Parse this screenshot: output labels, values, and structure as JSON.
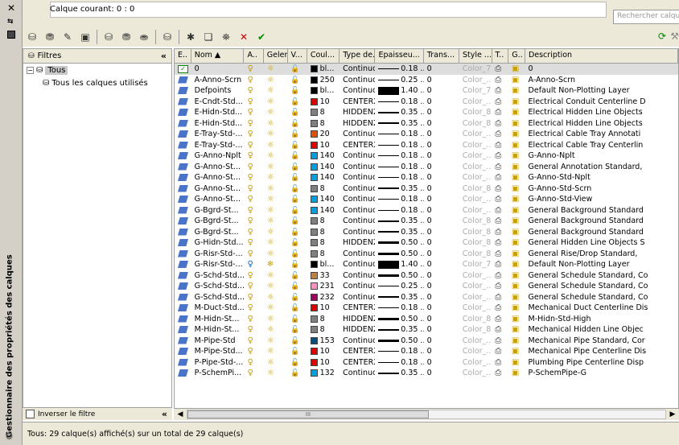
{
  "strip": {
    "title": "Gestionnaire des propriétés des calques",
    "close_icon": "close-icon",
    "autohide_icon": "autohide-icon",
    "menu_icon": "properties-menu-icon"
  },
  "header": {
    "current_layer": "Calque courant: 0 : 0",
    "search_placeholder": "Rechercher calque"
  },
  "toolbar": {
    "buttons": [
      "new-filter-icon",
      "new-group-filter-icon",
      "state-manager-icon",
      "save-icon",
      "layer-isolate-icon",
      "layer-walk-icon",
      "layer-match-icon",
      "layer-previous-icon",
      "new-layer-icon",
      "new-vp-frozen-layer-icon",
      "set-current-icon",
      "delete-layer-icon",
      "set-current-check-icon"
    ],
    "refresh_icon": "refresh-icon",
    "settings_icon": "settings-wrench-icon"
  },
  "filters": {
    "title": "Filtres",
    "tree_root": "Tous",
    "tree_child": "Tous les calques utilisés",
    "invert_label": "Inverser le filtre"
  },
  "columns": [
    "E..",
    "Nom",
    "A..",
    "Geler",
    "V...",
    "Coul...",
    "Type de...",
    "Epaisseu...",
    "Trans...",
    "Style ...",
    "T..",
    "G..",
    "Description"
  ],
  "rows": [
    {
      "name": "0",
      "color": "#000000",
      "color_label": "bl...",
      "ltype": "Continuo...",
      "lw": "0.18 ...",
      "lw_h": 1,
      "trans": "0",
      "style": "Color_7",
      "desc": "0",
      "current": true,
      "style_grey": true
    },
    {
      "name": "A-Anno-Scrn",
      "color": "#000000",
      "color_label": "250",
      "ltype": "Continuo...",
      "lw": "0.25 ...",
      "lw_h": 1,
      "trans": "0",
      "style": "Color_...",
      "desc": "A-Anno-Scrn"
    },
    {
      "name": "Defpoints",
      "color": "#000000",
      "color_label": "bl...",
      "ltype": "Continuo...",
      "lw": "1.40 ...",
      "lw_h": 10,
      "trans": "0",
      "style": "Color_7",
      "desc": "Default Non-Plotting Layer",
      "noplot": true
    },
    {
      "name": "E-Cndt-Std...",
      "color": "#e00000",
      "color_label": "10",
      "ltype": "CENTER2",
      "lw": "0.18 ...",
      "lw_h": 1,
      "trans": "0",
      "style": "Color_...",
      "desc": "Electrical Conduit Centerline D"
    },
    {
      "name": "E-Hidn-Std...",
      "color": "#808080",
      "color_label": "8",
      "ltype": "HIDDEN2",
      "lw": "0.35 ...",
      "lw_h": 2,
      "trans": "0",
      "style": "Color_8",
      "desc": "Electrical Hidden Line Objects"
    },
    {
      "name": "E-Hidn-Std...",
      "color": "#808080",
      "color_label": "8",
      "ltype": "HIDDEN2",
      "lw": "0.35 ...",
      "lw_h": 2,
      "trans": "0",
      "style": "Color_8",
      "desc": "Electrical Hidden Line Objects"
    },
    {
      "name": "E-Tray-Std-...",
      "color": "#e05000",
      "color_label": "20",
      "ltype": "Continuo...",
      "lw": "0.18 ...",
      "lw_h": 1,
      "trans": "0",
      "style": "Color_...",
      "desc": "Electrical Cable Tray Annotati"
    },
    {
      "name": "E-Tray-Std-...",
      "color": "#e00000",
      "color_label": "10",
      "ltype": "CENTER2",
      "lw": "0.18 ...",
      "lw_h": 1,
      "trans": "0",
      "style": "Color_...",
      "desc": "Electrical Cable Tray Centerlin"
    },
    {
      "name": "G-Anno-Nplt",
      "color": "#00a0e0",
      "color_label": "140",
      "ltype": "Continuo...",
      "lw": "0.18 ...",
      "lw_h": 1,
      "trans": "0",
      "style": "Color_...",
      "desc": "G-Anno-Nplt",
      "noplot": true
    },
    {
      "name": "G-Anno-St...",
      "color": "#00a0e0",
      "color_label": "140",
      "ltype": "Continuo...",
      "lw": "0.18 ...",
      "lw_h": 1,
      "trans": "0",
      "style": "Color_...",
      "desc": "General Annotation Standard,"
    },
    {
      "name": "G-Anno-St...",
      "color": "#00a0e0",
      "color_label": "140",
      "ltype": "Continuo...",
      "lw": "0.18 ...",
      "lw_h": 1,
      "trans": "0",
      "style": "Color_...",
      "desc": "G-Anno-Std-Nplt",
      "noplot": true
    },
    {
      "name": "G-Anno-St...",
      "color": "#808080",
      "color_label": "8",
      "ltype": "Continuo...",
      "lw": "0.35 ...",
      "lw_h": 2,
      "trans": "0",
      "style": "Color_8",
      "desc": "G-Anno-Std-Scrn"
    },
    {
      "name": "G-Anno-St...",
      "color": "#00a0e0",
      "color_label": "140",
      "ltype": "Continuo...",
      "lw": "0.18 ...",
      "lw_h": 1,
      "trans": "0",
      "style": "Color_...",
      "desc": "G-Anno-Std-View",
      "noplot": true
    },
    {
      "name": "G-Bgrd-St...",
      "color": "#00a0e0",
      "color_label": "140",
      "ltype": "Continuo...",
      "lw": "0.18 ...",
      "lw_h": 1,
      "trans": "0",
      "style": "Color_...",
      "desc": "General Background Standard"
    },
    {
      "name": "G-Bgrd-St...",
      "color": "#808080",
      "color_label": "8",
      "ltype": "Continuo...",
      "lw": "0.35 ...",
      "lw_h": 2,
      "trans": "0",
      "style": "Color_8",
      "desc": "General Background Standard"
    },
    {
      "name": "G-Bgrd-St...",
      "color": "#808080",
      "color_label": "8",
      "ltype": "Continuo...",
      "lw": "0.35 ...",
      "lw_h": 2,
      "trans": "0",
      "style": "Color_8",
      "desc": "General Background Standard",
      "noplot": true
    },
    {
      "name": "G-Hidn-Std...",
      "color": "#808080",
      "color_label": "8",
      "ltype": "HIDDEN2",
      "lw": "0.50 ...",
      "lw_h": 3,
      "trans": "0",
      "style": "Color_8",
      "desc": "General Hidden Line Objects S"
    },
    {
      "name": "G-Risr-Std-...",
      "color": "#808080",
      "color_label": "8",
      "ltype": "Continuo...",
      "lw": "0.50 ...",
      "lw_h": 3,
      "trans": "0",
      "style": "Color_8",
      "desc": "General Rise/Drop Standard,"
    },
    {
      "name": "G-Risr-Std-...",
      "color": "#000000",
      "color_label": "bl...",
      "ltype": "Continuo...",
      "lw": "1.40 ...",
      "lw_h": 10,
      "trans": "0",
      "style": "Color_7",
      "desc": "Default Non-Plotting Layer",
      "off": true
    },
    {
      "name": "G-Schd-Std...",
      "color": "#c08040",
      "color_label": "33",
      "ltype": "Continuo...",
      "lw": "0.50 ...",
      "lw_h": 3,
      "trans": "0",
      "style": "Color_...",
      "desc": "General Schedule Standard, Co"
    },
    {
      "name": "G-Schd-Std...",
      "color": "#ff90c0",
      "color_label": "231",
      "ltype": "Continuo...",
      "lw": "0.25 ...",
      "lw_h": 1,
      "trans": "0",
      "style": "Color_...",
      "desc": "General Schedule Standard, Co"
    },
    {
      "name": "G-Schd-Std...",
      "color": "#a00060",
      "color_label": "232",
      "ltype": "Continuo...",
      "lw": "0.35 ...",
      "lw_h": 2,
      "trans": "0",
      "style": "Color_...",
      "desc": "General Schedule Standard, Co"
    },
    {
      "name": "M-Duct-Std...",
      "color": "#e00000",
      "color_label": "10",
      "ltype": "CENTER2",
      "lw": "0.18 ...",
      "lw_h": 1,
      "trans": "0",
      "style": "Color_...",
      "desc": "Mechanical Duct Centerline Dis"
    },
    {
      "name": "M-Hidn-St...",
      "color": "#808080",
      "color_label": "8",
      "ltype": "HIDDEN2",
      "lw": "0.50 ...",
      "lw_h": 3,
      "trans": "0",
      "style": "Color_8",
      "desc": "M-Hidn-Std-High"
    },
    {
      "name": "M-Hidn-St...",
      "color": "#808080",
      "color_label": "8",
      "ltype": "HIDDEN2",
      "lw": "0.35 ...",
      "lw_h": 2,
      "trans": "0",
      "style": "Color_8",
      "desc": "Mechanical Hidden Line Objec"
    },
    {
      "name": "M-Pipe-Std",
      "color": "#005080",
      "color_label": "153",
      "ltype": "Continuo...",
      "lw": "0.50 ...",
      "lw_h": 3,
      "trans": "0",
      "style": "Color_...",
      "desc": "Mechanical Pipe Standard, Cor"
    },
    {
      "name": "M-Pipe-Std...",
      "color": "#e00000",
      "color_label": "10",
      "ltype": "CENTER2",
      "lw": "0.18 ...",
      "lw_h": 1,
      "trans": "0",
      "style": "Color_...",
      "desc": "Mechanical Pipe Centerline Dis"
    },
    {
      "name": "P-Pipe-Std-...",
      "color": "#e00000",
      "color_label": "10",
      "ltype": "CENTER2",
      "lw": "0.18 ...",
      "lw_h": 1,
      "trans": "0",
      "style": "Color_...",
      "desc": "Plumbing Pipe Centerline Disp"
    },
    {
      "name": "P-SchemPi...",
      "color": "#00a0e0",
      "color_label": "132",
      "ltype": "Continuo...",
      "lw": "0.35 ...",
      "lw_h": 2,
      "trans": "0",
      "style": "Color_...",
      "desc": "P-SchemPipe-G"
    }
  ],
  "scrollbar_grip": "III",
  "status": "Tous: 29 calque(s) affiché(s) sur un total de 29 calque(s)"
}
